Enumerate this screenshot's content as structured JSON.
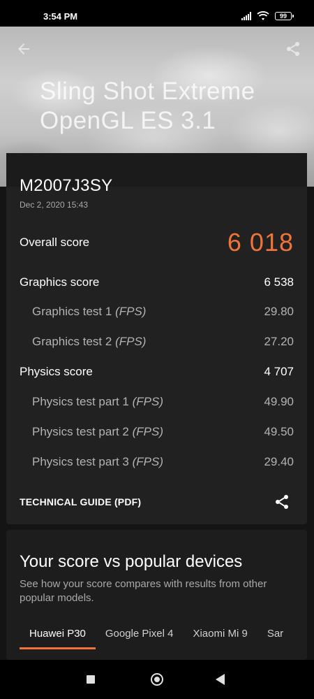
{
  "status_bar": {
    "time": "3:54 PM",
    "battery": "99"
  },
  "hero": {
    "title_line1": "Sling Shot Extreme",
    "title_line2": "OpenGL ES 3.1"
  },
  "result": {
    "device": "M2007J3SY",
    "date": "Dec 2, 2020 15:43",
    "overall_label": "Overall score",
    "overall_value": "6 018",
    "graphics_label": "Graphics score",
    "graphics_value": "6 538",
    "gt1_label": "Graphics test 1 ",
    "gt1_unit": "(FPS)",
    "gt1_value": "29.80",
    "gt2_label": "Graphics test 2 ",
    "gt2_unit": "(FPS)",
    "gt2_value": "27.20",
    "physics_label": "Physics score",
    "physics_value": "4 707",
    "pt1_label": "Physics test part 1 ",
    "pt1_unit": "(FPS)",
    "pt1_value": "49.90",
    "pt2_label": "Physics test part 2 ",
    "pt2_unit": "(FPS)",
    "pt2_value": "49.50",
    "pt3_label": "Physics test part 3 ",
    "pt3_unit": "(FPS)",
    "pt3_value": "29.40",
    "guide_link": "TECHNICAL GUIDE (PDF)"
  },
  "compare": {
    "title": "Your score vs popular devices",
    "description": "See how your score compares with results from other popular models.",
    "tabs": [
      "Huawei P30",
      "Google Pixel 4",
      "Xiaomi Mi 9",
      "Sar"
    ]
  },
  "colors": {
    "accent": "#f0743a",
    "background": "#141414",
    "card": "#212121"
  },
  "icons": [
    "back-arrow-icon",
    "share-icon",
    "wifi-icon",
    "signal-icon",
    "battery-icon",
    "nav-recents-icon",
    "nav-home-icon",
    "nav-back-icon"
  ]
}
